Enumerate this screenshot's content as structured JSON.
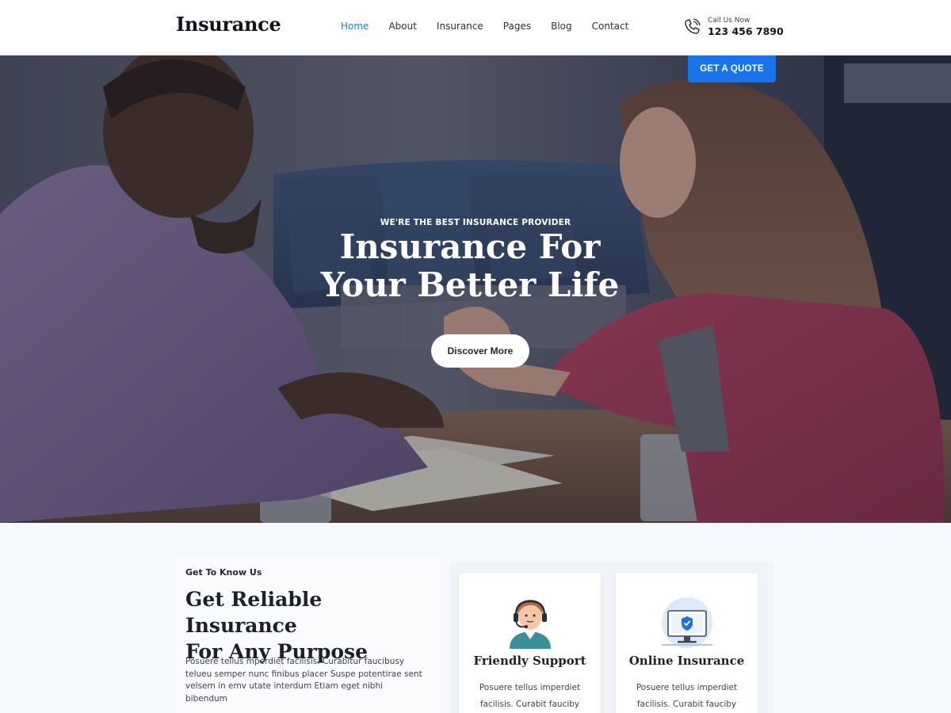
{
  "header": {
    "logo": "Insurance",
    "nav": [
      "Home",
      "About",
      "Insurance",
      "Pages",
      "Blog",
      "Contact"
    ],
    "active_nav": "Home",
    "call_label": "Call Us Now",
    "call_number": "123 456 7890",
    "quote_button": "GET A QUOTE"
  },
  "hero": {
    "kicker": "WE'RE THE BEST INSURANCE PROVIDER",
    "title_line1": "Insurance For",
    "title_line2": "Your Better Life",
    "button": "Discover More"
  },
  "about": {
    "kicker": "Get To Know Us",
    "title_line1": "Get Reliable Insurance",
    "title_line2": "For Any Purpose",
    "text": "Posuere tellus mperdiet facilisis. Curabitur faucibusy teluеu semper nunc finibus placer Suspe potentirae sent velsem in emv utate interdum Etiam eget nibhi bibendum"
  },
  "cards": [
    {
      "title": "Friendly Support",
      "text": "Posuere tellus imperdiet facilisis. Curabit fauciby",
      "icon": "support-agent-icon"
    },
    {
      "title": "Online Insurance",
      "text": "Posuere tellus imperdiet facilisis. Curabit fauciby",
      "icon": "monitor-shield-icon"
    }
  ],
  "colors": {
    "accent": "#1a73e8",
    "nav_active": "#1f7be1",
    "section_bg": "#f5f8fc"
  }
}
